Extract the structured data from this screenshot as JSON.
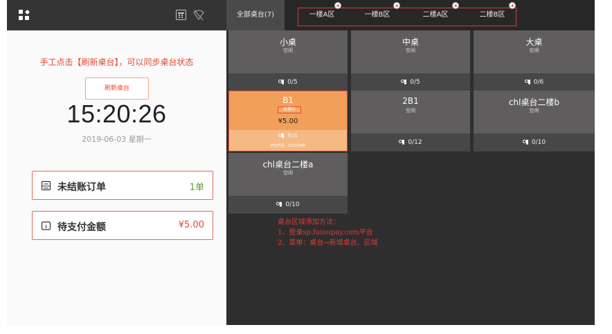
{
  "left": {
    "hint": "手工点击【刷新桌台】，可以同步桌台状态",
    "refresh_label": "刷新桌台",
    "clock": "15:20:26",
    "date": "2019-06-03 星期一",
    "stats": [
      {
        "label": "未结账订单",
        "value": "1单",
        "icon": "receipt-icon"
      },
      {
        "label": "待支付金额",
        "value": "¥5.00",
        "icon": "wallet-icon"
      }
    ]
  },
  "tabs": [
    {
      "label": "全部桌台(7)",
      "active": true
    },
    {
      "label": "一楼A区"
    },
    {
      "label": "一楼B区"
    },
    {
      "label": "二楼A区"
    },
    {
      "label": "二楼B区"
    }
  ],
  "tables": [
    {
      "name": "小桌",
      "status": "空闲",
      "seats": "0/5"
    },
    {
      "name": "中桌",
      "status": "空闲",
      "seats": "0/5"
    },
    {
      "name": "大桌",
      "status": "空闲",
      "seats": "0/6"
    },
    {
      "name": "B1",
      "status": "就餐中",
      "price": "¥5.00",
      "seats": "8/4",
      "open_time": "开台时间：222分26秒",
      "active": true
    },
    {
      "name": "2B1",
      "status": "空闲",
      "seats": "0/12"
    },
    {
      "name": "chl桌台二楼b",
      "status": "空闲",
      "seats": "0/10"
    },
    {
      "name": "chl桌台二楼a",
      "status": "空闲",
      "seats": "0/10"
    }
  ],
  "note": {
    "title": "桌台区域添加方法：",
    "line1": "1、登录sp.fuioupay.com平台",
    "line2": "2、菜单：桌台→新增桌台、区域"
  },
  "colors": {
    "accent": "#e8472e",
    "active_card": "#f29f5a",
    "stat_value": "#5aa02c"
  }
}
